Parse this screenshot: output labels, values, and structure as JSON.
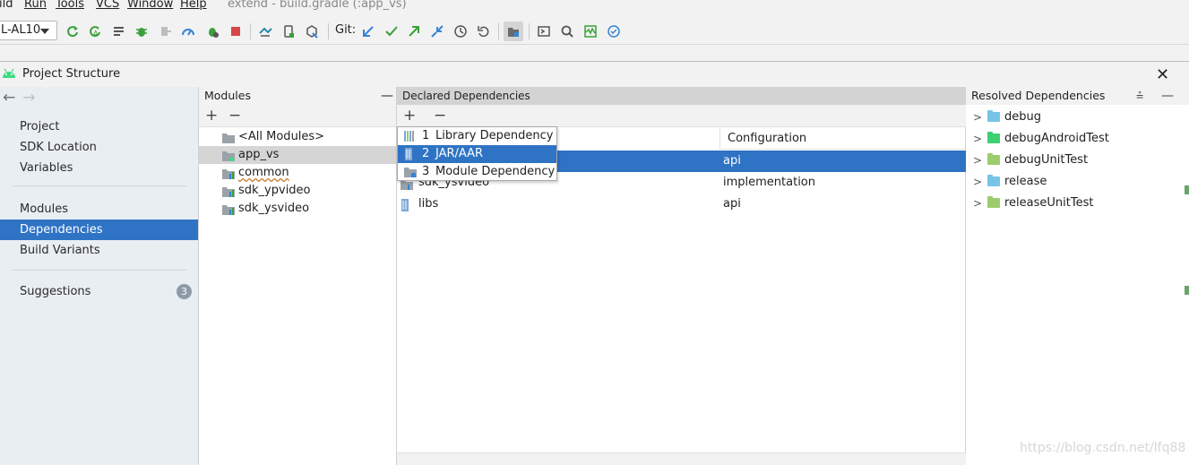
{
  "menubar": {
    "items": [
      "ild",
      "Run",
      "Tools",
      "VCS",
      "Window",
      "Help"
    ],
    "window_title": "extend - build.gradle (:app_vs)"
  },
  "toolbar": {
    "device": "L-AL10",
    "git_label": "Git:",
    "icons": [
      "apply-changes-restart-icon",
      "apply-code-changes-icon",
      "logcat-icon",
      "debug-icon",
      "attach-debugger-icon",
      "profile-icon",
      "debug-bug-icon",
      "stop-icon",
      "sync-icon",
      "device-manager-icon",
      "sdk-manager-icon",
      "git-update-icon",
      "git-commit-icon",
      "git-push-icon",
      "git-fetch-icon",
      "history-icon",
      "rollback-icon",
      "project-structure-icon",
      "terminal-icon",
      "search-icon",
      "profiler-icon",
      "check-icon"
    ],
    "colors": {
      "green": "#3ba03b",
      "blue": "#3584d6",
      "red": "#d94646"
    }
  },
  "dialog": {
    "title": "Project Structure",
    "close": "✕"
  },
  "nav": {
    "items": [
      {
        "label": "Project"
      },
      {
        "label": "SDK Location"
      },
      {
        "label": "Variables"
      },
      {
        "label": "Modules"
      },
      {
        "label": "Dependencies",
        "selected": true
      },
      {
        "label": "Build Variants"
      },
      {
        "label": "Suggestions",
        "badge": "3"
      }
    ]
  },
  "modules": {
    "header": "Modules",
    "rows": [
      "<All Modules>",
      "app_vs",
      "common",
      "sdk_ypvideo",
      "sdk_ysvideo"
    ],
    "selected": "app_vs"
  },
  "declared": {
    "header": "Declared Dependencies",
    "col_configuration": "Configuration",
    "rows": [
      {
        "name": "",
        "configuration": "api"
      },
      {
        "name": "sdk_ysvideo",
        "configuration": "implementation"
      },
      {
        "name": "libs",
        "configuration": "api"
      }
    ]
  },
  "popup": {
    "items": [
      {
        "num": "1",
        "label": "Library Dependency"
      },
      {
        "num": "2",
        "label": "JAR/AAR Dependency",
        "selected": true
      },
      {
        "num": "3",
        "label": "Module Dependency"
      }
    ]
  },
  "resolved": {
    "header": "Resolved Dependencies",
    "rows": [
      {
        "label": "debug",
        "color": "#77c4e8"
      },
      {
        "label": "debugAndroidTest",
        "color": "#3ecf72"
      },
      {
        "label": "debugUnitTest",
        "color": "#9ccc6e"
      },
      {
        "label": "release",
        "color": "#77c4e8"
      },
      {
        "label": "releaseUnitTest",
        "color": "#9ccc6e"
      }
    ]
  },
  "watermark": "https://blog.csdn.net/lfq88"
}
